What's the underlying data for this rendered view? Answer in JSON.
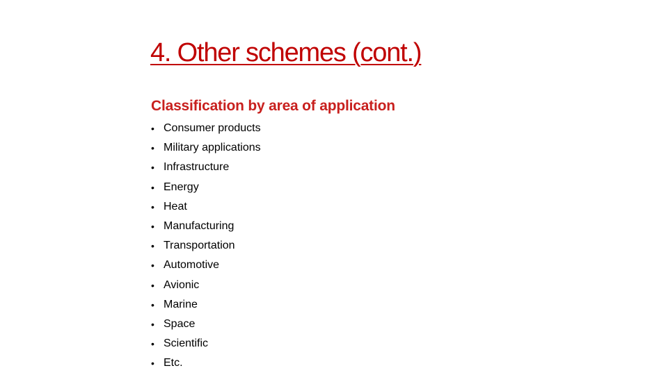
{
  "slide": {
    "title": "4. Other schemes (cont.)",
    "subtitle": "Classification by area of application",
    "bullet_glyph": "•",
    "items": [
      {
        "label": "Consumer products"
      },
      {
        "label": "Military applications"
      },
      {
        "label": "Infrastructure"
      },
      {
        "label": "Energy"
      },
      {
        "label": "Heat"
      },
      {
        "label": "Manufacturing"
      },
      {
        "label": "Transportation"
      },
      {
        "label": "Automotive"
      },
      {
        "label": "Avionic"
      },
      {
        "label": "Marine"
      },
      {
        "label": "Space"
      },
      {
        "label": "Scientific"
      },
      {
        "label": "Etc."
      }
    ]
  },
  "colors": {
    "title": "#C00000",
    "subtitle": "#C8201E",
    "body_text": "#000000",
    "background": "#FFFFFF"
  }
}
